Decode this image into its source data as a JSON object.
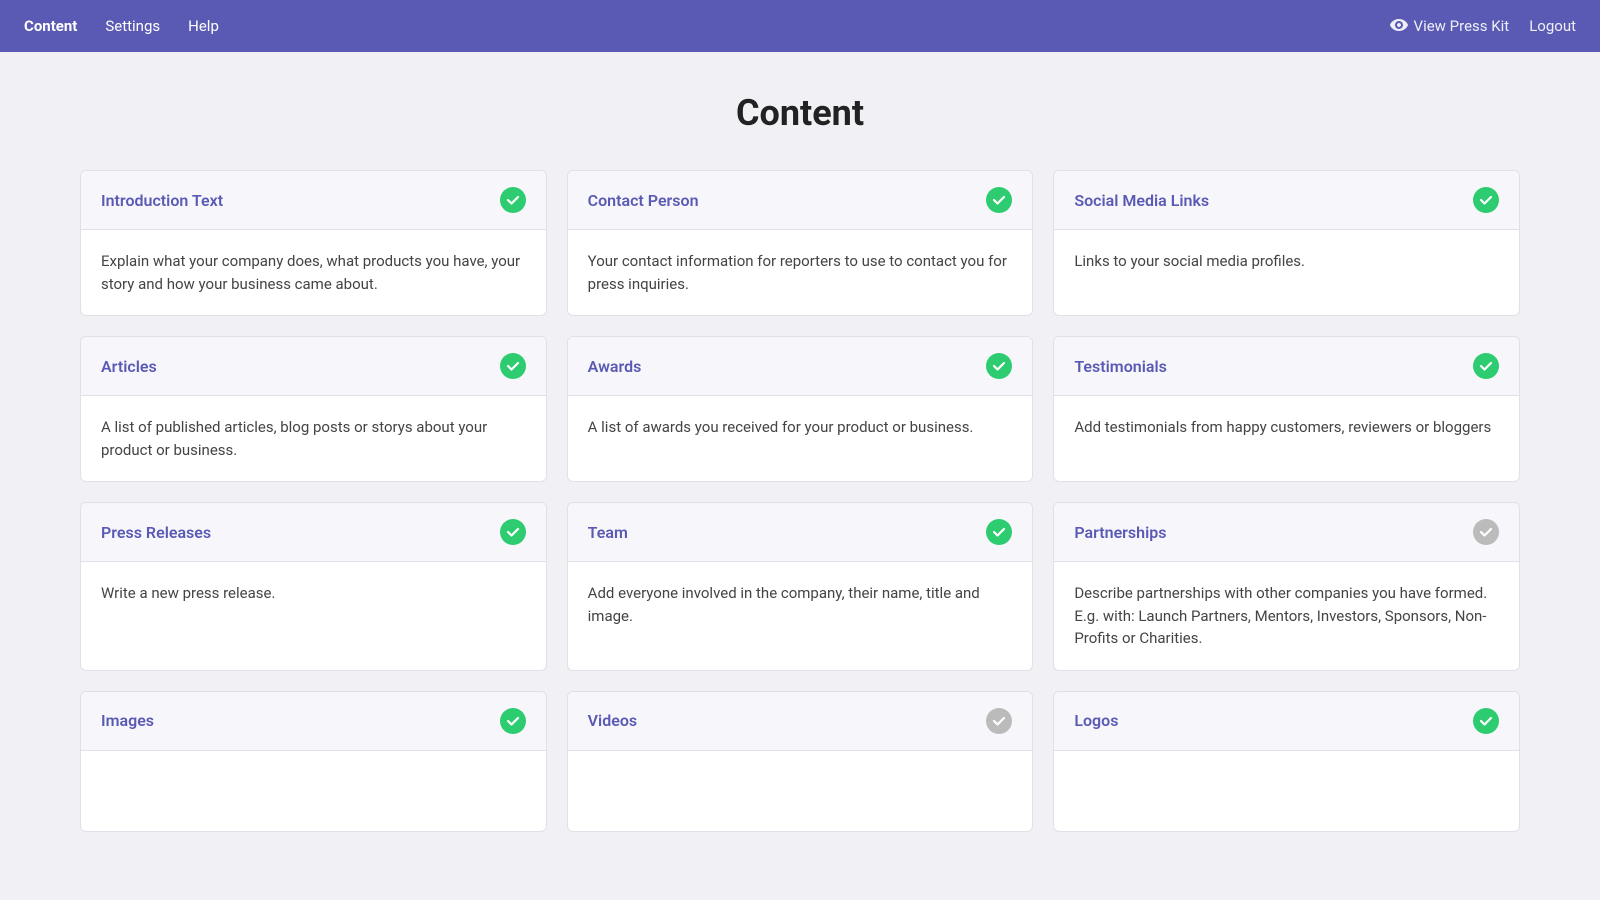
{
  "nav": {
    "items": [
      {
        "label": "Content",
        "active": true
      },
      {
        "label": "Settings",
        "active": false
      },
      {
        "label": "Help",
        "active": false
      }
    ],
    "right_items": [
      {
        "label": "View Press Kit",
        "icon": "eye-icon"
      },
      {
        "label": "Logout"
      }
    ]
  },
  "page": {
    "title": "Content"
  },
  "cards": [
    {
      "title": "Introduction Text",
      "description": "Explain what your company does, what products you have, your story and how your business came about.",
      "status": "green"
    },
    {
      "title": "Contact Person",
      "description": "Your contact information for reporters to use to contact you for press inquiries.",
      "status": "green"
    },
    {
      "title": "Social Media Links",
      "description": "Links to your social media profiles.",
      "status": "green"
    },
    {
      "title": "Articles",
      "description": "A list of published articles, blog posts or storys about your product or business.",
      "status": "green"
    },
    {
      "title": "Awards",
      "description": "A list of awards you received for your product or business.",
      "status": "green"
    },
    {
      "title": "Testimonials",
      "description": "Add testimonials from happy customers, reviewers or bloggers",
      "status": "green"
    },
    {
      "title": "Press Releases",
      "description": "Write a new press release.",
      "status": "green"
    },
    {
      "title": "Team",
      "description": "Add everyone involved in the company, their name, title and image.",
      "status": "green"
    },
    {
      "title": "Partnerships",
      "description": "Describe partnerships with other companies you have formed. E.g. with: Launch Partners, Mentors, Investors, Sponsors, Non-Profits or Charities.",
      "status": "gray"
    },
    {
      "title": "Images",
      "description": "",
      "status": "green"
    },
    {
      "title": "Videos",
      "description": "",
      "status": "gray"
    },
    {
      "title": "Logos",
      "description": "",
      "status": "green"
    }
  ],
  "icons": {
    "check": "✓",
    "eye": "👁"
  }
}
